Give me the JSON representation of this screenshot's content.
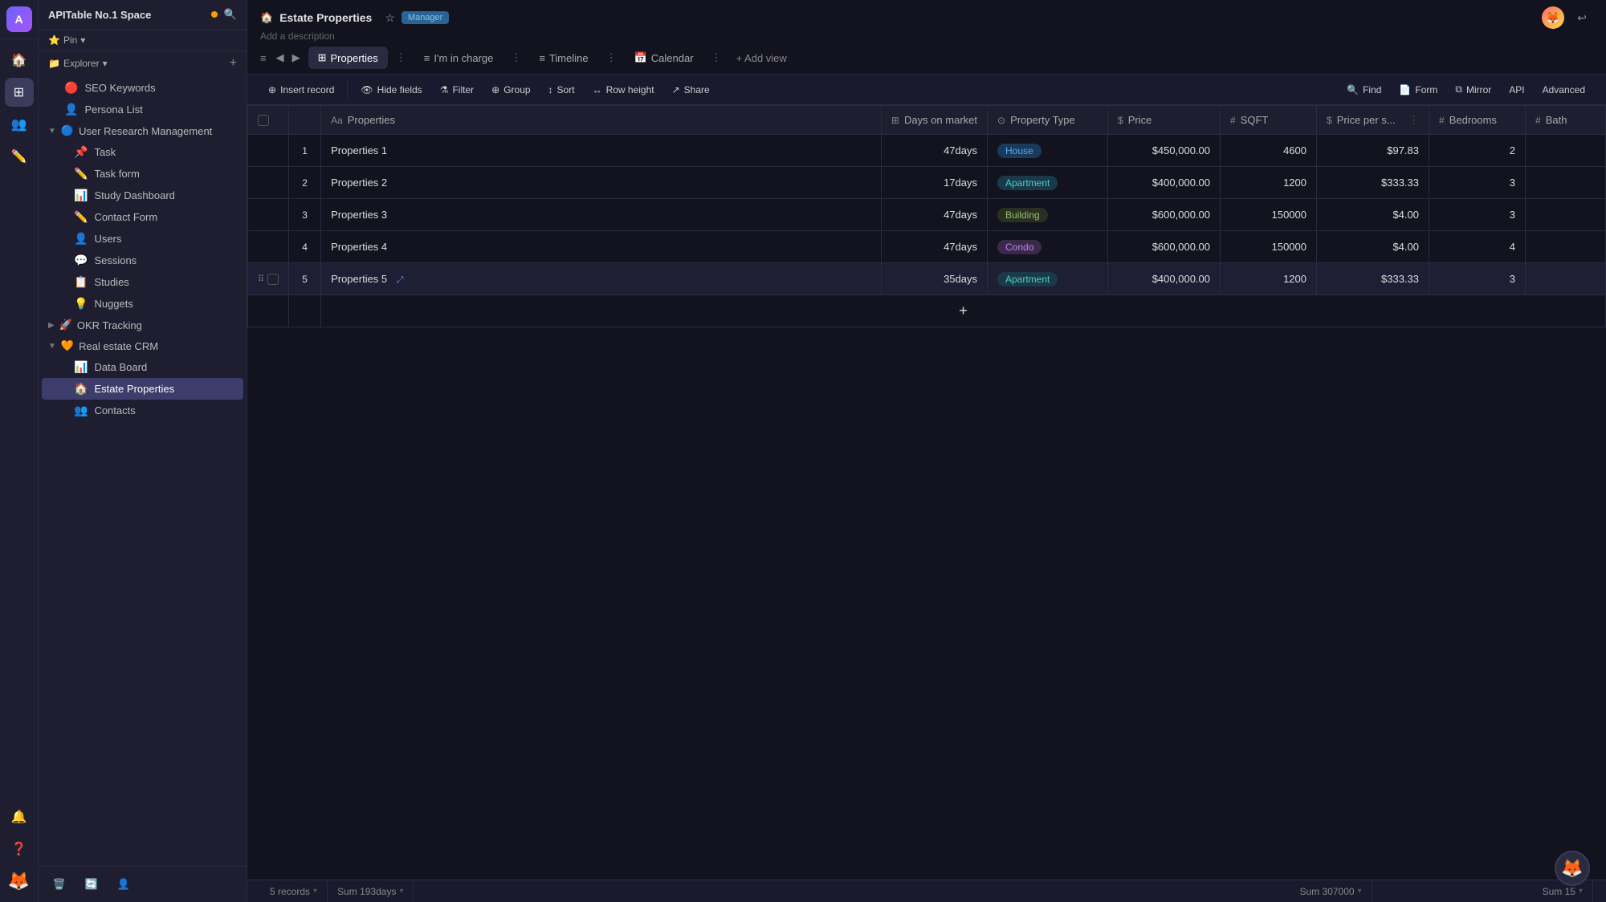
{
  "workspace": {
    "title": "APITable No.1 Space",
    "avatar_label": "A"
  },
  "pin_bar": {
    "label": "Pin",
    "arrow": "▾"
  },
  "explorer": {
    "label": "Explorer",
    "arrow": "▾",
    "add_icon": "+"
  },
  "sidebar": {
    "items": [
      {
        "id": "seo-keywords",
        "icon": "🔴",
        "label": "SEO Keywords",
        "indent": 1
      },
      {
        "id": "persona-list",
        "icon": "👤",
        "label": "Persona List",
        "indent": 1
      },
      {
        "id": "user-research-mgmt",
        "icon": "🔵",
        "label": "User Research Management",
        "indent": 0,
        "group": true,
        "expanded": true
      },
      {
        "id": "task",
        "icon": "📌",
        "label": "Task",
        "indent": 2
      },
      {
        "id": "task-form",
        "icon": "✏️",
        "label": "Task form",
        "indent": 2
      },
      {
        "id": "study-dashboard",
        "icon": "📊",
        "label": "Study Dashboard",
        "indent": 2
      },
      {
        "id": "contact-form",
        "icon": "✏️",
        "label": "Contact Form",
        "indent": 2
      },
      {
        "id": "users",
        "icon": "👤",
        "label": "Users",
        "indent": 2
      },
      {
        "id": "sessions",
        "icon": "💬",
        "label": "Sessions",
        "indent": 2
      },
      {
        "id": "studies",
        "icon": "📋",
        "label": "Studies",
        "indent": 2
      },
      {
        "id": "nuggets",
        "icon": "💡",
        "label": "Nuggets",
        "indent": 2
      },
      {
        "id": "okr-tracking",
        "icon": "🚀",
        "label": "OKR Tracking",
        "indent": 0,
        "group": true,
        "expanded": false
      },
      {
        "id": "real-estate-crm",
        "icon": "🧡",
        "label": "Real estate CRM",
        "indent": 0,
        "group": true,
        "expanded": true
      },
      {
        "id": "data-board",
        "icon": "📊",
        "label": "Data Board",
        "indent": 2
      },
      {
        "id": "estate-properties",
        "icon": "🏠",
        "label": "Estate Properties",
        "indent": 2,
        "active": true
      },
      {
        "id": "contacts",
        "icon": "👥",
        "label": "Contacts",
        "indent": 2
      }
    ]
  },
  "topbar": {
    "title": "Estate Properties",
    "title_icon": "🏠",
    "star_icon": "☆",
    "manager_badge": "Manager",
    "description": "Add a description",
    "tabs": [
      {
        "id": "properties",
        "icon": "⊞",
        "label": "Properties",
        "active": true
      },
      {
        "id": "im-in-charge",
        "icon": "≡",
        "label": "I'm in charge"
      },
      {
        "id": "timeline",
        "icon": "≡",
        "label": "Timeline"
      },
      {
        "id": "calendar",
        "icon": "📅",
        "label": "Calendar"
      }
    ],
    "add_view_label": "+ Add view",
    "more_icon": "⋮"
  },
  "toolbar": {
    "insert_record": "Insert record",
    "hide_fields": "Hide fields",
    "filter": "Filter",
    "group": "Group",
    "sort": "Sort",
    "row_height": "Row height",
    "share": "Share",
    "find": "Find",
    "form": "Form",
    "mirror": "Mirror",
    "api": "API",
    "advanced": "Advanced"
  },
  "table": {
    "columns": [
      {
        "id": "properties",
        "icon": "Aa",
        "label": "Properties"
      },
      {
        "id": "days-on-market",
        "icon": "⊞",
        "label": "Days on market"
      },
      {
        "id": "property-type",
        "icon": "⊙",
        "label": "Property Type"
      },
      {
        "id": "price",
        "icon": "$",
        "label": "Price"
      },
      {
        "id": "sqft",
        "icon": "#",
        "label": "SQFT"
      },
      {
        "id": "price-per-sqft",
        "icon": "$",
        "label": "Price per s..."
      },
      {
        "id": "bedrooms",
        "icon": "#",
        "label": "Bedrooms"
      },
      {
        "id": "bath",
        "icon": "#",
        "label": "Bath"
      }
    ],
    "rows": [
      {
        "num": 1,
        "name": "Properties 1",
        "days": "47days",
        "type": "House",
        "type_style": "house",
        "price": "$450,000.00",
        "sqft": "4600",
        "price_per": "$97.83",
        "bedrooms": "2"
      },
      {
        "num": 2,
        "name": "Properties 2",
        "days": "17days",
        "type": "Apartment",
        "type_style": "apartment",
        "price": "$400,000.00",
        "sqft": "1200",
        "price_per": "$333.33",
        "bedrooms": "3"
      },
      {
        "num": 3,
        "name": "Properties 3",
        "days": "47days",
        "type": "Building",
        "type_style": "building",
        "price": "$600,000.00",
        "sqft": "150000",
        "price_per": "$4.00",
        "bedrooms": "3"
      },
      {
        "num": 4,
        "name": "Properties 4",
        "days": "47days",
        "type": "Condo",
        "type_style": "condo",
        "price": "$600,000.00",
        "sqft": "150000",
        "price_per": "$4.00",
        "bedrooms": "4"
      },
      {
        "num": 5,
        "name": "Properties 5",
        "days": "35days",
        "type": "Apartment",
        "type_style": "apartment",
        "price": "$400,000.00",
        "sqft": "1200",
        "price_per": "$333.33",
        "bedrooms": "3"
      }
    ]
  },
  "statusbar": {
    "records": "5 records",
    "records_dropdown": "▾",
    "sum_days": "Sum 193days",
    "sum_days_dropdown": "▾",
    "sum_sqft": "Sum 307000",
    "sum_sqft_dropdown": "▾",
    "sum_bedrooms": "Sum 15",
    "sum_bedrooms_dropdown": "▾"
  },
  "floating_avatar": "🦊"
}
